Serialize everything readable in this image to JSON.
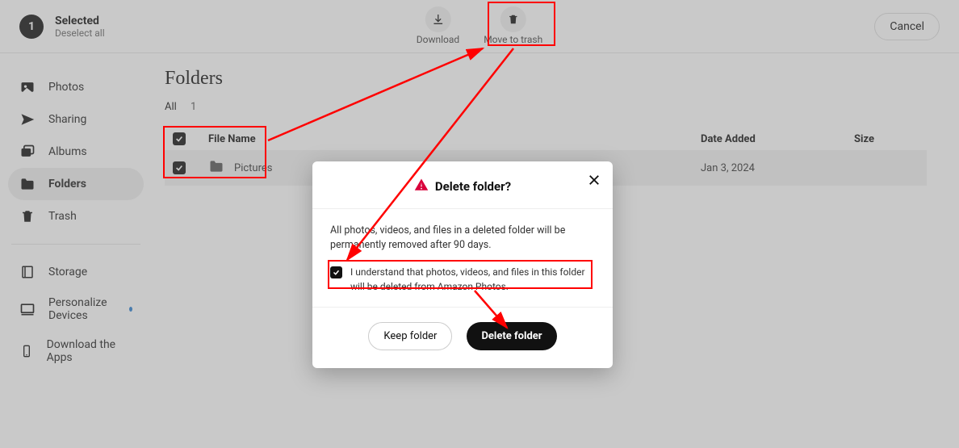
{
  "header": {
    "selected_count": "1",
    "selected_title": "Selected",
    "deselect_label": "Deselect all",
    "download_label": "Download",
    "trash_label": "Move to trash",
    "cancel_label": "Cancel"
  },
  "sidebar": {
    "items": [
      {
        "label": "Photos"
      },
      {
        "label": "Sharing"
      },
      {
        "label": "Albums"
      },
      {
        "label": "Folders"
      },
      {
        "label": "Trash"
      }
    ],
    "lower": [
      {
        "label": "Storage"
      },
      {
        "label": "Personalize Devices"
      },
      {
        "label": "Download the Apps"
      }
    ]
  },
  "content": {
    "title": "Folders",
    "filter_all": "All",
    "filter_count": "1",
    "columns": {
      "name": "File Name",
      "date": "Date Added",
      "size": "Size"
    },
    "rows": [
      {
        "name": "Pictures",
        "date": "Jan 3, 2024",
        "size": ""
      }
    ]
  },
  "modal": {
    "title": "Delete folder?",
    "warning": "All photos, videos, and files in a deleted folder will be permanently removed after 90 days.",
    "consent": "I understand that photos, videos, and files in this folder will be deleted from Amazon Photos.",
    "keep_label": "Keep folder",
    "delete_label": "Delete folder"
  }
}
